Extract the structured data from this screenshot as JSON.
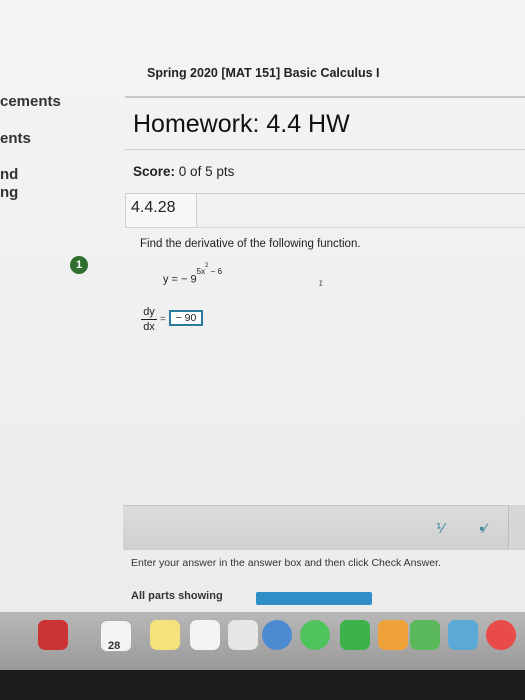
{
  "sidebar": {
    "items": [
      {
        "label": "cements"
      },
      {
        "label": "ents"
      },
      {
        "label": "nd"
      },
      {
        "label": "ng"
      }
    ]
  },
  "course": {
    "title": "Spring 2020 [MAT 151] Basic Calculus I"
  },
  "homework": {
    "title": "Homework: 4.4 HW"
  },
  "score": {
    "label": "Score:",
    "value": "0 of 5 pts"
  },
  "question": {
    "number": "4.4.28",
    "badge": "1",
    "prompt": "Find the derivative of the following function.",
    "equation_lhs": "y = − 9",
    "exp_base": "5x",
    "exp_power": "2",
    "exp_tail": " − 6",
    "deriv_num": "dy",
    "deriv_den": "dx",
    "equals": "=",
    "answer": "− 90"
  },
  "footer": {
    "hint": "Enter your answer in the answer box and then click Check Answer.",
    "parts_label": "All parts showing",
    "progress": 1.0
  },
  "dock": {
    "calendar_date": "28",
    "icons": [
      "launchpad-icon",
      "calendar-icon",
      "notes-icon",
      "photos-icon",
      "chrome-icon",
      "messages-icon",
      "facetime-icon",
      "pages-icon",
      "numbers-icon",
      "preview-icon",
      "safari-icon"
    ]
  },
  "colors": {
    "accent": "#2d8fc6",
    "badge": "#2f6f2f",
    "answer_border": "#2a7a9a"
  }
}
